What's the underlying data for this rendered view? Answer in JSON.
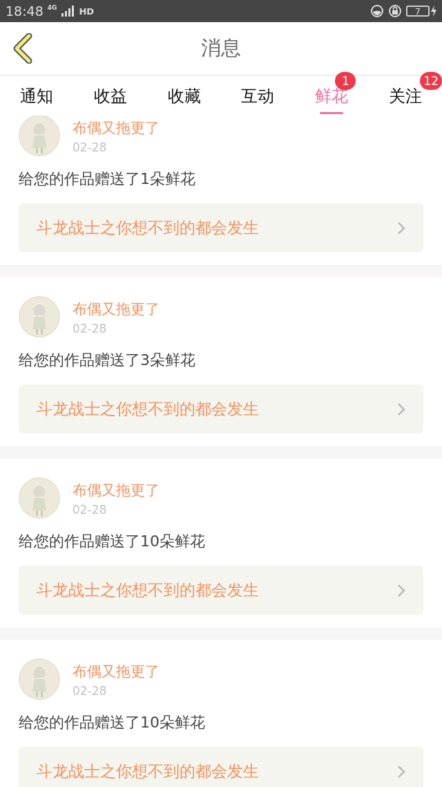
{
  "status_bar": {
    "time": "18:48",
    "network": "4G",
    "hd": "HD",
    "battery": "7",
    "charging": true
  },
  "header": {
    "title": "消息"
  },
  "tabs": [
    {
      "label": "通知",
      "selected": false
    },
    {
      "label": "收益",
      "selected": false
    },
    {
      "label": "收藏",
      "selected": false
    },
    {
      "label": "互动",
      "selected": false
    },
    {
      "label": "鲜花",
      "selected": true,
      "badge": "1"
    },
    {
      "label": "关注",
      "selected": false,
      "badge": "12"
    }
  ],
  "messages": [
    {
      "user": "布偶又拖更了",
      "date": "02-28",
      "text": "给您的作品赠送了1朵鲜花",
      "work": "斗龙战士之你想不到的都会发生"
    },
    {
      "user": "布偶又拖更了",
      "date": "02-28",
      "text": "给您的作品赠送了3朵鲜花",
      "work": "斗龙战士之你想不到的都会发生"
    },
    {
      "user": "布偶又拖更了",
      "date": "02-28",
      "text": "给您的作品赠送了10朵鲜花",
      "work": "斗龙战士之你想不到的都会发生"
    },
    {
      "user": "布偶又拖更了",
      "date": "02-28",
      "text": "给您的作品赠送了10朵鲜花",
      "work": "斗龙战士之你想不到的都会发生"
    }
  ]
}
